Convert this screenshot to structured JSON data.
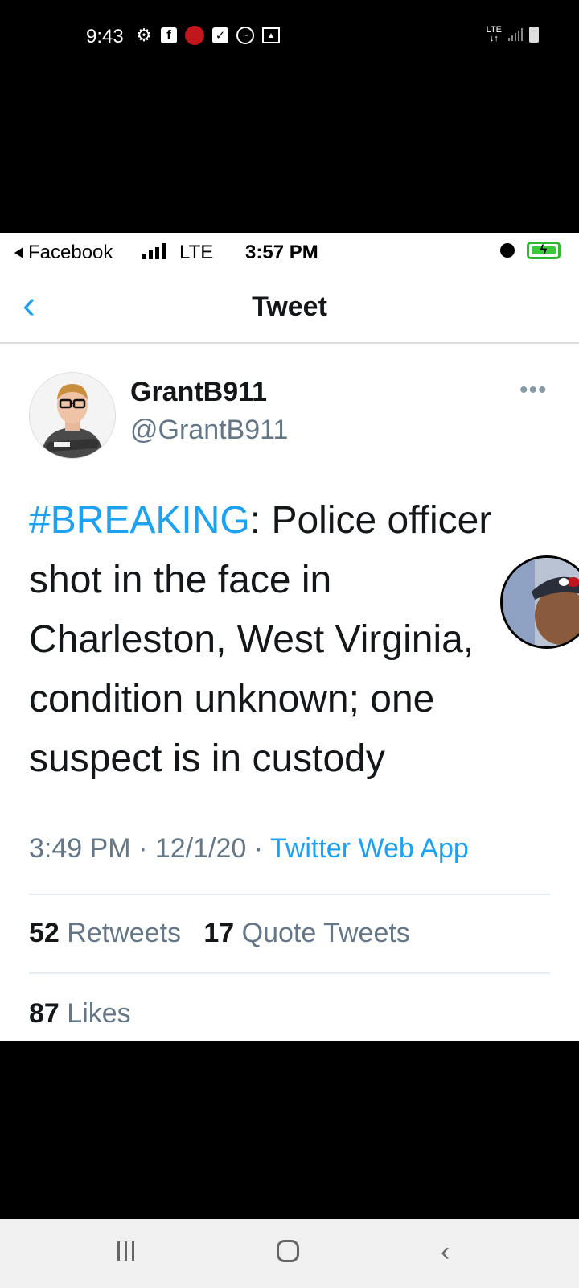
{
  "android_status": {
    "time": "9:43",
    "notification_icons": [
      "gear-icon",
      "facebook-icon",
      "red-app-icon",
      "check-icon",
      "messenger-icon",
      "image-icon"
    ],
    "network": "LTE"
  },
  "ios_status": {
    "back_app": "Facebook",
    "network": "LTE",
    "time": "3:57 PM"
  },
  "nav": {
    "title": "Tweet",
    "back_icon": "chevron-left-icon"
  },
  "tweet": {
    "display_name": "GrantB911",
    "handle": "@GrantB911",
    "more_label": "•••",
    "hashtag": "#BREAKING",
    "text_rest": ": Police officer shot in the face in Charleston, West Virginia, condition unknown; one suspect is in custody",
    "time": "3:49 PM",
    "sep": " · ",
    "date": "12/1/20",
    "source": "Twitter Web App",
    "retweets_count": "52",
    "retweets_label": "Retweets",
    "quotes_count": "17",
    "quotes_label": "Quote Tweets",
    "likes_count": "87",
    "likes_label": "Likes"
  },
  "colors": {
    "link": "#1da1f2",
    "secondary_text": "#657786",
    "battery": "#3cc83c"
  }
}
